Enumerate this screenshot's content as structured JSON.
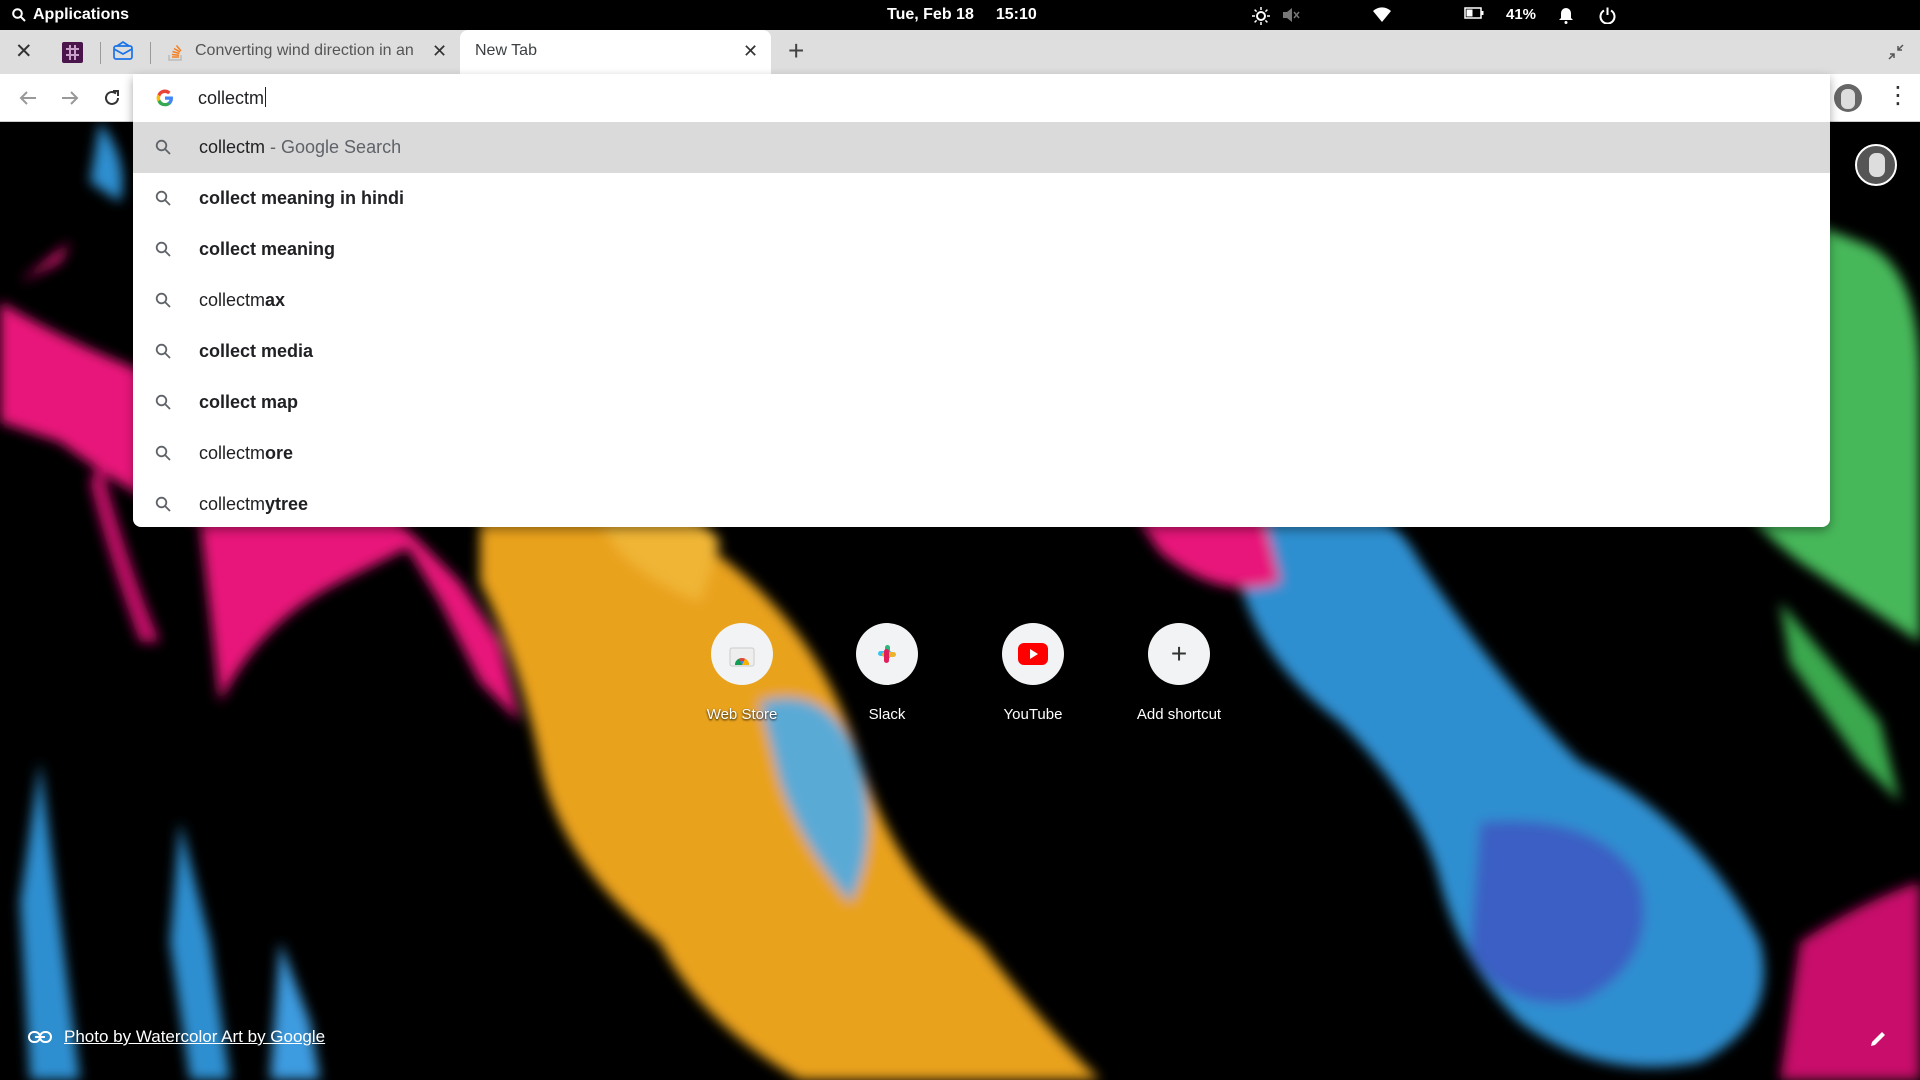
{
  "system_bar": {
    "applications_label": "Applications",
    "date": "Tue, Feb 18",
    "time": "15:10",
    "battery_percent": "41%"
  },
  "tabs": [
    {
      "title": "",
      "icon": "slack-icon"
    },
    {
      "title": "",
      "icon": "mail-icon"
    },
    {
      "title": "Converting wind direction in an",
      "icon": "stackoverflow-icon"
    },
    {
      "title": "New Tab",
      "active": true
    }
  ],
  "omnibox": {
    "query": "collectm",
    "suggestions": [
      {
        "plain": "collectm",
        "bold": "",
        "desc": " - Google Search",
        "selected": true
      },
      {
        "plain": "",
        "bold": "collect meaning in hindi",
        "desc": ""
      },
      {
        "plain": "",
        "bold": "collect meaning",
        "desc": ""
      },
      {
        "plain": "collectm",
        "bold": "ax",
        "desc": ""
      },
      {
        "plain": "",
        "bold": "collect media",
        "desc": ""
      },
      {
        "plain": "",
        "bold": "collect map",
        "desc": ""
      },
      {
        "plain": "collectm",
        "bold": "ore",
        "desc": ""
      },
      {
        "plain": "collectm",
        "bold": "ytree",
        "desc": ""
      }
    ]
  },
  "shortcuts": [
    {
      "label": "Web Store",
      "icon": "webstore-icon"
    },
    {
      "label": "Slack",
      "icon": "slack-icon"
    },
    {
      "label": "YouTube",
      "icon": "youtube-icon"
    },
    {
      "label": "Add shortcut",
      "icon": "plus-icon"
    }
  ],
  "background_credit": "Photo by Watercolor Art by Google",
  "colors": {
    "magenta": "#e8157a",
    "orange": "#e9a21d",
    "blue": "#2f8fd0",
    "green": "#46b85a"
  }
}
